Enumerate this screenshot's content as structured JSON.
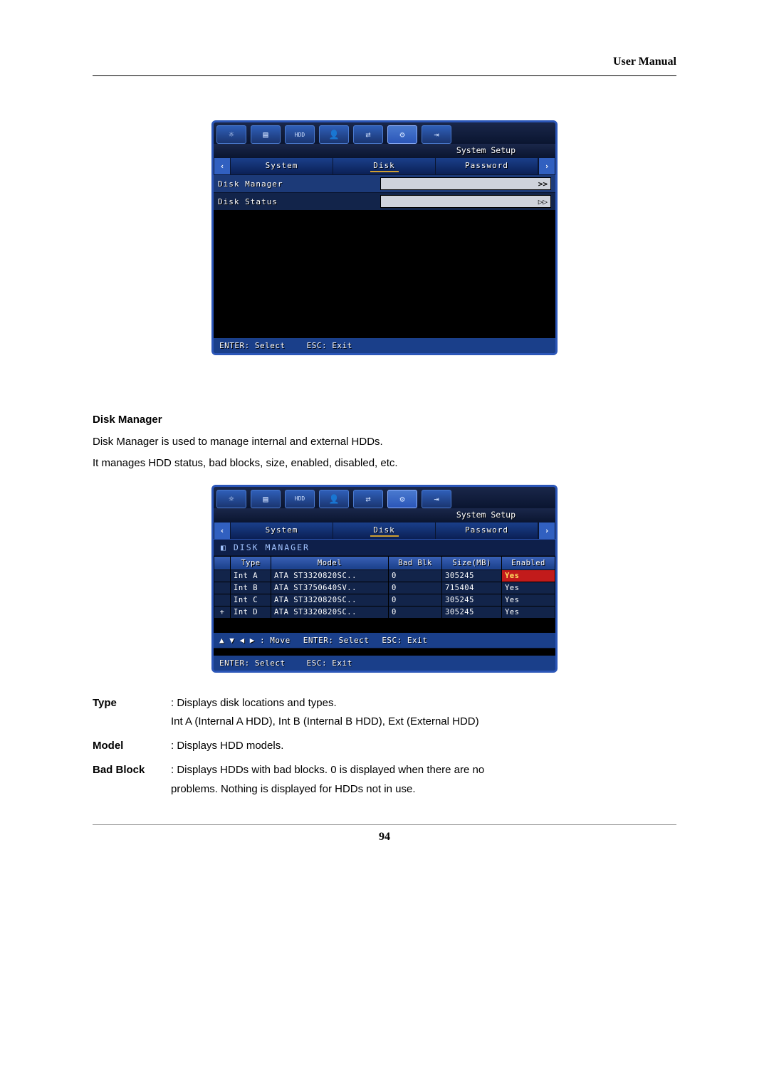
{
  "header": {
    "title": "User Manual"
  },
  "screenshot1": {
    "toolbar_icons": [
      "brightness-icon",
      "display-icon",
      "hdd-icon",
      "user-icon",
      "network-icon",
      "setup-icon",
      "login-icon"
    ],
    "systemsetup_label": "System Setup",
    "scroll_left": "‹",
    "scroll_right": "›",
    "tabs": [
      "System",
      "Disk",
      "Password"
    ],
    "options": {
      "disk_manager": "Disk Manager",
      "disk_status": "Disk Status"
    },
    "row_arrow": ">>",
    "row_arrow2": "▷▷",
    "footer_enter": "ENTER: Select",
    "footer_esc": "ESC: Exit"
  },
  "body": {
    "h": "Disk Manager",
    "p1": "Disk Manager is used to manage internal and external HDDs.",
    "p2": "It manages HDD status, bad blocks, size, enabled, disabled, etc."
  },
  "screenshot2": {
    "toolbar_icons": [
      "brightness-icon",
      "display-icon",
      "hdd-icon",
      "user-icon",
      "network-icon",
      "setup-icon",
      "login-icon"
    ],
    "systemsetup_label": "System Setup",
    "scroll_left": "‹",
    "scroll_right": "›",
    "tabs": [
      "System",
      "Disk",
      "Password"
    ],
    "section_title": "DISK MANAGER",
    "columns": [
      "Type",
      "Model",
      "Bad Blk",
      "Size(MB)",
      "Enabled"
    ],
    "rows": [
      {
        "type": "Int A",
        "model": "ATA ST3320820SC..",
        "bad": "0",
        "size": "305245",
        "enabled": "Yes",
        "hl": true
      },
      {
        "type": "Int B",
        "model": "ATA ST3750640SV..",
        "bad": "0",
        "size": "715404",
        "enabled": "Yes",
        "hl": false
      },
      {
        "type": "Int C",
        "model": "ATA ST3320820SC..",
        "bad": "0",
        "size": "305245",
        "enabled": "Yes",
        "hl": false
      },
      {
        "type": "Int D",
        "model": "ATA ST3320820SC..",
        "bad": "0",
        "size": "305245",
        "enabled": "Yes",
        "hl": false
      }
    ],
    "plus": "+",
    "move_hint": "▲ ▼ ◀ ▶ : Move",
    "enter_hint": "ENTER: Select",
    "esc_hint": "ESC: Exit",
    "footer_enter": "ENTER: Select",
    "footer_esc": "ESC: Exit"
  },
  "defs": {
    "type_term": "Type",
    "type_body1": ": Displays disk locations and types.",
    "type_body2": "Int A (Internal A HDD), Int B (Internal B HDD), Ext (External HDD)",
    "model_term": "Model",
    "model_body": ": Displays HDD models.",
    "bad_term": "Bad Block",
    "bad_body1": ": Displays HDDs with bad blocks. 0 is displayed when there are no",
    "bad_body2": "problems. Nothing is displayed for HDDs not in use."
  },
  "page_number": "94"
}
